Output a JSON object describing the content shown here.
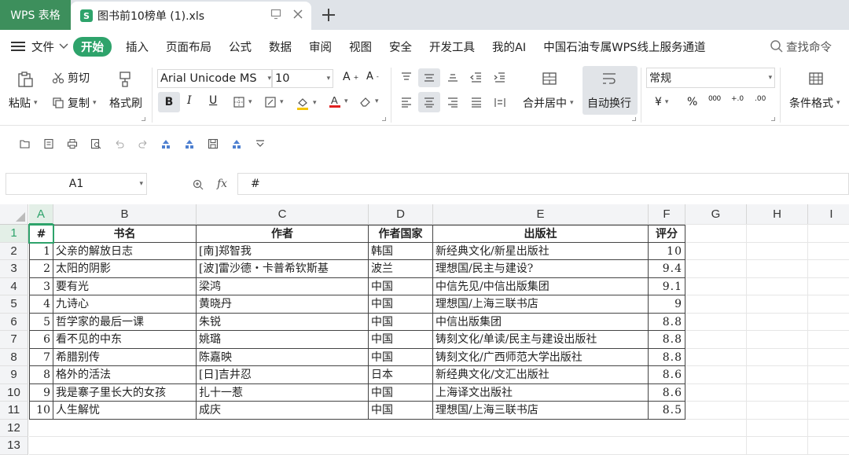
{
  "tabs": {
    "app": "WPS 表格",
    "doc_title": "图书前10榜单 (1).xls",
    "doc_icon": "S"
  },
  "menu": {
    "file": "文件",
    "start": "开始",
    "items": [
      "插入",
      "页面布局",
      "公式",
      "数据",
      "审阅",
      "视图",
      "安全",
      "开发工具",
      "我的AI",
      "中国石油专属WPS线上服务通道"
    ],
    "search": "查找命令"
  },
  "ribbon": {
    "paste": "粘贴",
    "cut": "剪切",
    "copy": "复制",
    "format_painter": "格式刷",
    "font": "Arial Unicode MS",
    "size": "10",
    "bold": "B",
    "italic": "I",
    "underline": "U",
    "merge_center": "合并居中",
    "wrap_text": "自动换行",
    "number_format": "常规",
    "currency": "¥",
    "percent": "%",
    "conditional_format": "条件格式"
  },
  "formula_bar": {
    "cell_ref": "A1",
    "fx": "fx",
    "content": "#"
  },
  "columns": [
    "A",
    "B",
    "C",
    "D",
    "E",
    "F",
    "G",
    "H",
    "I"
  ],
  "rows": [
    "1",
    "2",
    "3",
    "4",
    "5",
    "6",
    "7",
    "8",
    "9",
    "10",
    "11",
    "12",
    "13"
  ],
  "table": {
    "headers": [
      "#",
      "书名",
      "作者",
      "作者国家",
      "出版社",
      "评分"
    ],
    "data": [
      [
        "1",
        "父亲的解放日志",
        "[南]郑智我",
        "韩国",
        "新经典文化/新星出版社",
        "10"
      ],
      [
        "2",
        "太阳的阴影",
        "[波]雷沙德・卡普希钦斯基",
        "波兰",
        "理想国/民主与建设?",
        "9.4"
      ],
      [
        "3",
        "要有光",
        "梁鸿",
        "中国",
        "中信先见/中信出版集团",
        "9.1"
      ],
      [
        "4",
        "九诗心",
        "黄晓丹",
        "中国",
        "理想国/上海三联书店",
        "9"
      ],
      [
        "5",
        "哲学家的最后一课",
        "朱锐",
        "中国",
        "中信出版集团",
        "8.8"
      ],
      [
        "6",
        "看不见的中东",
        "姚璐",
        "中国",
        "铸刻文化/单读/民主与建设出版社",
        "8.8"
      ],
      [
        "7",
        "希腊别传",
        "陈嘉映",
        "中国",
        "铸刻文化/广西师范大学出版社",
        "8.8"
      ],
      [
        "8",
        "格外的活法",
        "[日]吉井忍",
        "日本",
        "新经典文化/文汇出版社",
        "8.6"
      ],
      [
        "9",
        "我是寨子里长大的女孩",
        "扎十一惹",
        "中国",
        "上海译文出版社",
        "8.6"
      ],
      [
        "10",
        "人生解忧",
        "成庆",
        "中国",
        "理想国/上海三联书店",
        "8.5"
      ]
    ]
  },
  "colors": {
    "accent": "#2ea36b",
    "app_tab": "#3d8f5c"
  }
}
